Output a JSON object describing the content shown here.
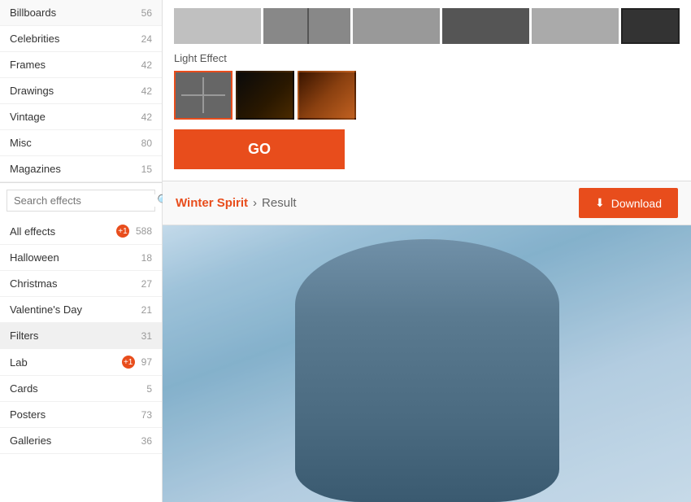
{
  "sidebar": {
    "search_placeholder": "Search effects",
    "items": [
      {
        "id": "billboards",
        "label": "Billboards",
        "count": "56",
        "badge": null,
        "active": false
      },
      {
        "id": "celebrities",
        "label": "Celebrities",
        "count": "24",
        "badge": null,
        "active": false
      },
      {
        "id": "frames",
        "label": "Frames",
        "count": "42",
        "badge": null,
        "active": false
      },
      {
        "id": "drawings",
        "label": "Drawings",
        "count": "42",
        "badge": null,
        "active": false
      },
      {
        "id": "vintage",
        "label": "Vintage",
        "count": "42",
        "badge": null,
        "active": false
      },
      {
        "id": "misc",
        "label": "Misc",
        "count": "80",
        "badge": null,
        "active": false
      },
      {
        "id": "magazines",
        "label": "Magazines",
        "count": "15",
        "badge": null,
        "active": false
      }
    ]
  },
  "effects_sidebar": {
    "search_placeholder": "Search effects",
    "items": [
      {
        "id": "all-effects",
        "label": "All effects",
        "count": "588",
        "badge": "+1",
        "active": false
      },
      {
        "id": "halloween",
        "label": "Halloween",
        "count": "18",
        "badge": null,
        "active": false
      },
      {
        "id": "christmas",
        "label": "Christmas",
        "count": "27",
        "badge": null,
        "active": false
      },
      {
        "id": "valentines-day",
        "label": "Valentine's Day",
        "count": "21",
        "badge": null,
        "active": false
      },
      {
        "id": "filters",
        "label": "Filters",
        "count": "31",
        "badge": null,
        "active": true
      },
      {
        "id": "lab",
        "label": "Lab",
        "count": "97",
        "badge": "+1",
        "active": false
      },
      {
        "id": "cards",
        "label": "Cards",
        "count": "5",
        "badge": null,
        "active": false
      },
      {
        "id": "posters",
        "label": "Posters",
        "count": "73",
        "badge": null,
        "active": false
      },
      {
        "id": "galleries",
        "label": "Galleries",
        "count": "36",
        "badge": null,
        "active": false
      }
    ]
  },
  "light_effect": {
    "label": "Light Effect"
  },
  "go_button": {
    "label": "GO"
  },
  "breadcrumb": {
    "link_label": "Winter Spirit",
    "separator": "›",
    "current": "Result"
  },
  "download_button": {
    "label": "Download",
    "icon": "⬇"
  },
  "colors": {
    "accent": "#e84d1c",
    "active_bg": "#f0f0f0"
  }
}
